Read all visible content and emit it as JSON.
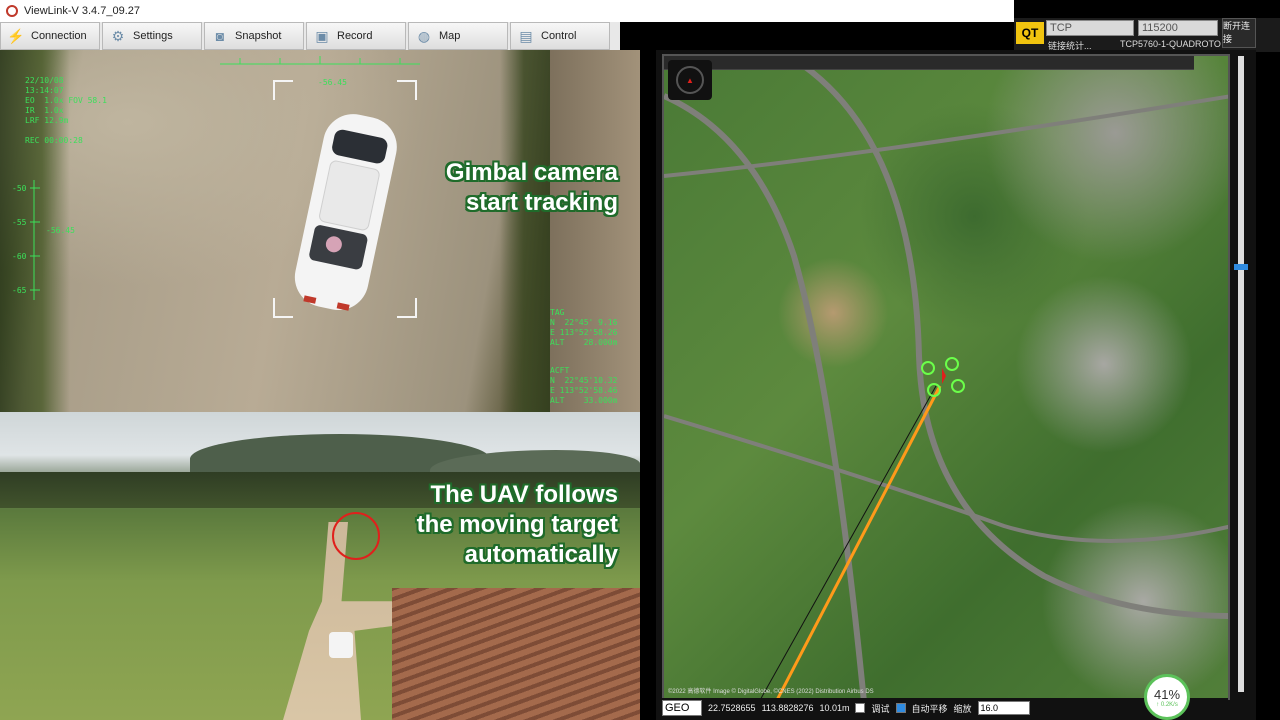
{
  "window": {
    "title": "ViewLink-V 3.4.7_09.27"
  },
  "toolbar": {
    "items": [
      {
        "label": "Connection",
        "icon": "plug-icon"
      },
      {
        "label": "Settings",
        "icon": "gear-icon"
      },
      {
        "label": "Snapshot",
        "icon": "camera-icon"
      },
      {
        "label": "Record",
        "icon": "record-icon"
      },
      {
        "label": "Map",
        "icon": "globe-icon"
      },
      {
        "label": "Control",
        "icon": "control-icon"
      }
    ]
  },
  "connection": {
    "protocol": "TCP",
    "baud": "115200",
    "stats_label": "链接统计...",
    "device": "TCP5760-1-QUADROTO",
    "disconnect_label": "断开连接"
  },
  "camera_hud": {
    "date": "22/10/08",
    "time": "13:14:07",
    "eo": "EO  1.0x FOV 58.1",
    "ir": "IR  1.0x",
    "lrf": "LRF 12.9m",
    "rec": "REC 00:00:28",
    "top_readout": "-56.45",
    "pitch_ticks": [
      "-50",
      "-55",
      "-60",
      "-65"
    ],
    "pitch_value": "-56.45",
    "tag_block": "TAG\nN  22°45' 9.16\nE 113°52'58.26\nALT    28.000m",
    "acft_block": "ACFT\nN  22°45'10.32\nE 113°52'58.46\nALT    33.000m",
    "overlay_text": "Gimbal camera\nstart tracking"
  },
  "ground_view": {
    "overlay_text": "The UAV follows\nthe moving target\nautomatically"
  },
  "map": {
    "coord_system": "GEO",
    "latitude": "22.7528655",
    "longitude": "113.8828276",
    "altitude": "10.01m",
    "debug_label": "调试",
    "auto_pan_label": "自动平移",
    "auto_pan_checked": true,
    "zoom_label": "缩放",
    "zoom_value": "16.0",
    "attribution": "©2022 高德软件  Image © DigitalGlobe, ©CNES (2022) Distribution Airbus DS"
  },
  "battery": {
    "percent": "41%",
    "rate": "↑ 0.2K/s"
  },
  "colors": {
    "hud_green": "#3be05a",
    "overlay_outline": "#1f6b2a",
    "target_red": "#e0201c",
    "track_orange": "#ff9a1a"
  }
}
